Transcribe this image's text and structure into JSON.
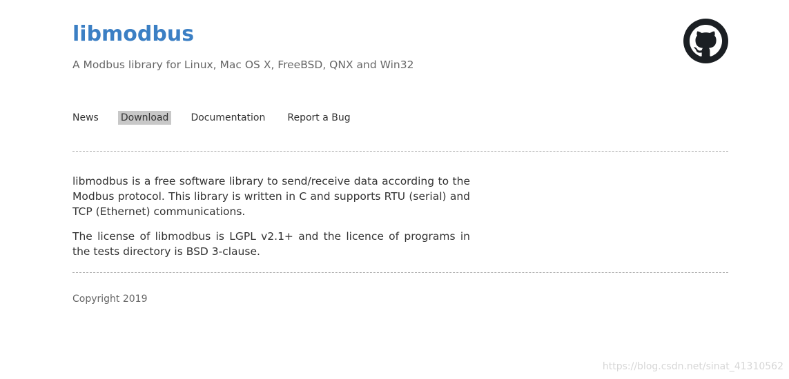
{
  "header": {
    "title": "libmodbus",
    "tagline": "A Modbus library for Linux, Mac OS X, FreeBSD, QNX and Win32",
    "github_icon": "github-icon"
  },
  "nav": {
    "items": [
      {
        "label": "News",
        "active": false
      },
      {
        "label": "Download",
        "active": true
      },
      {
        "label": "Documentation",
        "active": false
      },
      {
        "label": "Report a Bug",
        "active": false
      }
    ]
  },
  "content": {
    "paragraphs": [
      "libmodbus is a free software library to send/receive data according to the Modbus protocol. This library is written in C and supports RTU (serial) and TCP (Ethernet) communications.",
      "The license of libmodbus is LGPL v2.1+ and the licence of programs in the tests directory is BSD 3-clause."
    ]
  },
  "footer": {
    "copyright": "Copyright 2019"
  },
  "watermark": {
    "text": "https://blog.csdn.net/sinat_41310562"
  },
  "colors": {
    "title": "#3b7fc4",
    "active_nav_bg": "#c8c8c8",
    "divider": "#b0b0b0"
  }
}
